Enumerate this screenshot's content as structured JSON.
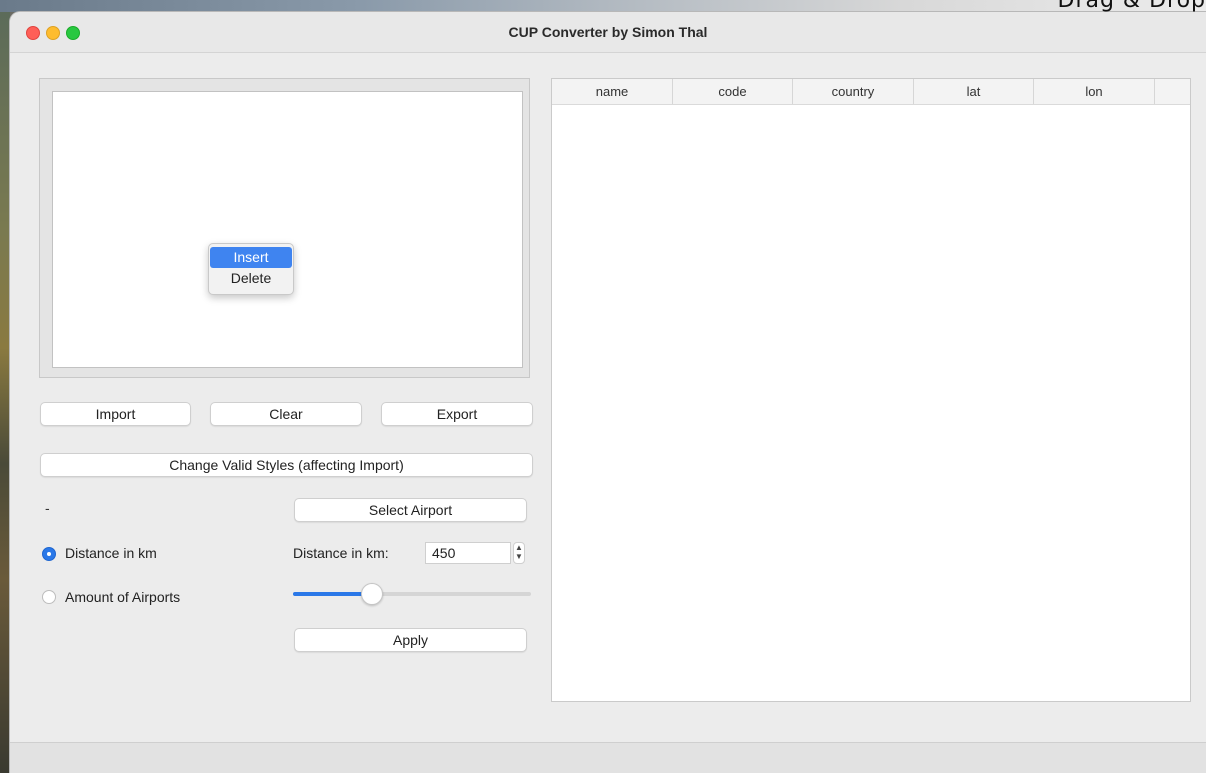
{
  "desktop": {
    "overlay_text": "Drag & Drop"
  },
  "window": {
    "title": "CUP Converter by Simon Thal"
  },
  "context_menu": {
    "items": [
      {
        "label": "Insert",
        "selected": true
      },
      {
        "label": "Delete",
        "selected": false
      }
    ]
  },
  "buttons": {
    "import": "Import",
    "clear": "Clear",
    "export": "Export",
    "change_styles": "Change Valid Styles (affecting Import)",
    "select_airport": "Select Airport",
    "apply": "Apply"
  },
  "airport_display": "-",
  "radio": {
    "distance": {
      "label": "Distance in km",
      "checked": true
    },
    "amount": {
      "label": "Amount of Airports",
      "checked": false
    }
  },
  "distance": {
    "label": "Distance in km:",
    "value": "450",
    "slider_fraction": 0.33
  },
  "table": {
    "columns": [
      "name",
      "code",
      "country",
      "lat",
      "lon"
    ]
  },
  "colors": {
    "accent": "#2a78e8",
    "menu_highlight": "#3f84f0"
  }
}
